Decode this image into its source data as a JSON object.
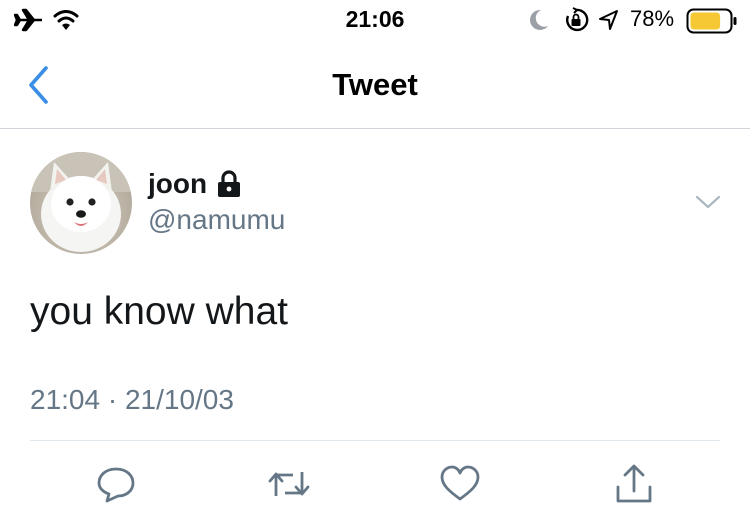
{
  "status_bar": {
    "time": "21:06",
    "battery_percent": "78%",
    "battery_level": 0.78,
    "icons": [
      "airplane-icon",
      "wifi-icon",
      "moon-icon",
      "rotation-lock-icon",
      "location-icon",
      "battery-icon"
    ]
  },
  "nav": {
    "title": "Tweet",
    "back_icon": "chevron-left-icon",
    "accent_color": "#3a8ee6"
  },
  "tweet": {
    "author": {
      "name": "joon",
      "handle": "@namumu",
      "protected": true,
      "avatar": "white spitz dog photo"
    },
    "text": "you know what",
    "timestamp": "21:04 · 21/10/03"
  },
  "actions": [
    {
      "name": "reply",
      "icon": "reply-icon"
    },
    {
      "name": "retweet",
      "icon": "retweet-icon"
    },
    {
      "name": "like",
      "icon": "heart-icon"
    },
    {
      "name": "share",
      "icon": "share-icon"
    }
  ],
  "colors": {
    "icon_gray": "#657786",
    "battery_fill": "#f6c834"
  }
}
